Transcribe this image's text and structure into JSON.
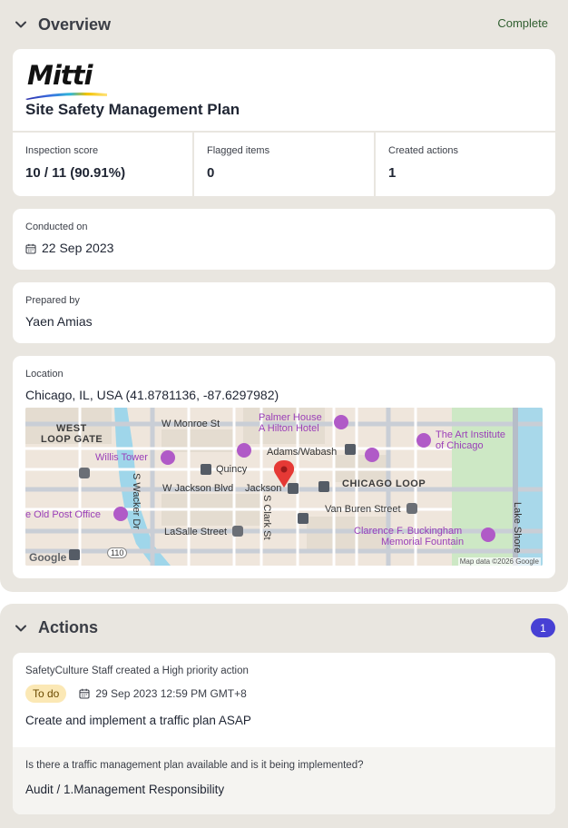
{
  "overview": {
    "title": "Overview",
    "status": "Complete",
    "logo_text": "Mitti",
    "doc_title": "Site Safety Management Plan",
    "stats": [
      {
        "label": "Inspection score",
        "value": "10 / 11 (90.91%)"
      },
      {
        "label": "Flagged items",
        "value": "0"
      },
      {
        "label": "Created actions",
        "value": "1"
      }
    ],
    "conducted": {
      "label": "Conducted on",
      "value": "22 Sep 2023"
    },
    "prepared": {
      "label": "Prepared by",
      "value": "Yaen Amias"
    },
    "location": {
      "label": "Location",
      "value": "Chicago, IL, USA (41.8781136, -87.6297982)",
      "map_labels": {
        "west_loop_1": "WEST",
        "west_loop_2": "LOOP GATE",
        "monroe": "W Monroe St",
        "palmer_1": "Palmer House",
        "palmer_2": "A Hilton Hotel",
        "art_1": "The Art Institute",
        "art_2": "of Chicago",
        "willis": "Willis Tower",
        "adams": "Adams/Wabash",
        "quincy": "Quincy",
        "jackson_blvd": "W Jackson Blvd",
        "jackson": "Jackson",
        "chicago_loop": "CHICAGO LOOP",
        "wacker": "S Wacker Dr",
        "clark": "S Clark St",
        "old_post": "e Old Post Office",
        "van_buren": "Van Buren Street",
        "lasalle": "LaSalle Street",
        "buckingham_1": "Clarence F. Buckingham",
        "buckingham_2": "Memorial Fountain",
        "lake_shore": "Lake Shore",
        "route": "110",
        "google": "Google",
        "attribution": "Map data ©2026 Google"
      }
    }
  },
  "actions": {
    "title": "Actions",
    "count": "1",
    "items": [
      {
        "meta": "SafetyCulture Staff created a High priority action",
        "status": "To do",
        "due": "29 Sep 2023 12:59 PM GMT+8",
        "title": "Create and implement a traffic plan ASAP",
        "question": "Is there a traffic management plan available and is it being implemented?",
        "breadcrumb": "Audit / 1.Management Responsibility"
      }
    ]
  },
  "colors": {
    "section_bg": "#e9e6e0",
    "status_complete": "#2f5e2f",
    "badge": "#4740d4",
    "todo_pill": "#fbe8b5",
    "map_pin": "#e53935"
  }
}
